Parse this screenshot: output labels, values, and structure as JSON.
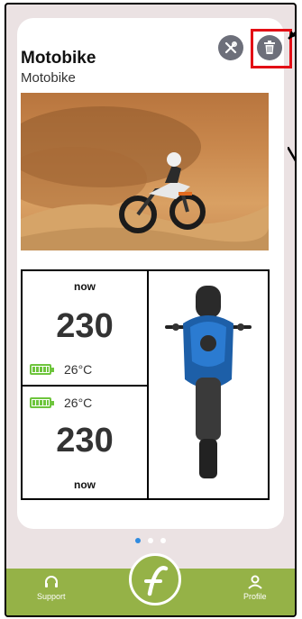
{
  "vehicle": {
    "title": "Motobike",
    "subtitle": "Motobike"
  },
  "actions": {
    "edit_icon": "wrench-screwdriver-icon",
    "delete_icon": "trash-icon"
  },
  "sensor_top": {
    "time": "now",
    "value": "230",
    "temp": "26°C",
    "battery_level": 1.0
  },
  "sensor_bottom": {
    "time": "now",
    "value": "230",
    "temp": "26°C",
    "battery_level": 1.0
  },
  "pager": {
    "count": 3,
    "active": 0
  },
  "nav": {
    "support_label": "Support",
    "profile_label": "Profile"
  },
  "colors": {
    "accent_green": "#95b247",
    "battery_green": "#6ec53d",
    "highlight_red": "#e30e15",
    "dot_active": "#2f8be0"
  }
}
